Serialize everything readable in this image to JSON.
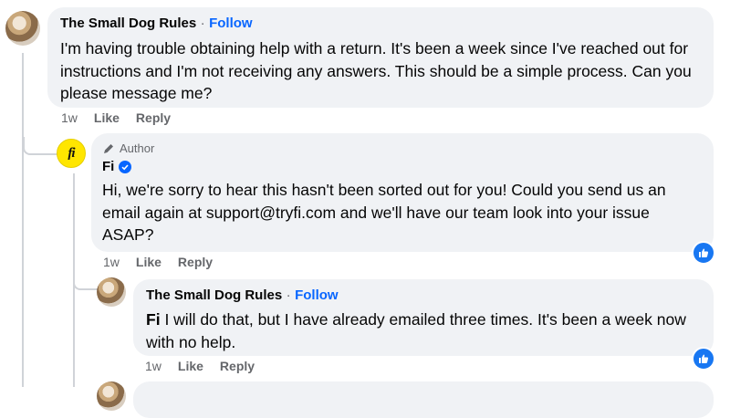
{
  "comments": [
    {
      "author": "The Small Dog Rules",
      "separator": "·",
      "follow": "Follow",
      "text": "I'm having trouble obtaining help with a return. It's been a week since I've reached out for instructions and I'm not receiving any answers. This should be a simple process. Can you please message me?",
      "time": "1w",
      "like": "Like",
      "reply": "Reply"
    },
    {
      "badge": "Author",
      "author": "Fi",
      "avatar_text": "fi",
      "text": "Hi, we're sorry to hear this hasn't been sorted out for you! Could you send us an email again at support@tryfi.com and we'll have our team look into your issue ASAP?",
      "time": "1w",
      "like": "Like",
      "reply": "Reply",
      "reaction_icon": "like-reaction-icon"
    },
    {
      "author": "The Small Dog Rules",
      "separator": "·",
      "follow": "Follow",
      "mention": "Fi",
      "text": "I will do that, but I have already emailed three times. It's been a week now with no help.",
      "time": "1w",
      "like": "Like",
      "reply": "Reply",
      "reaction_icon": "like-reaction-icon"
    }
  ],
  "colors": {
    "bubble": "#f0f2f5",
    "link": "#0866ff",
    "meta": "#65676b",
    "fi_brand": "#ffe600"
  }
}
